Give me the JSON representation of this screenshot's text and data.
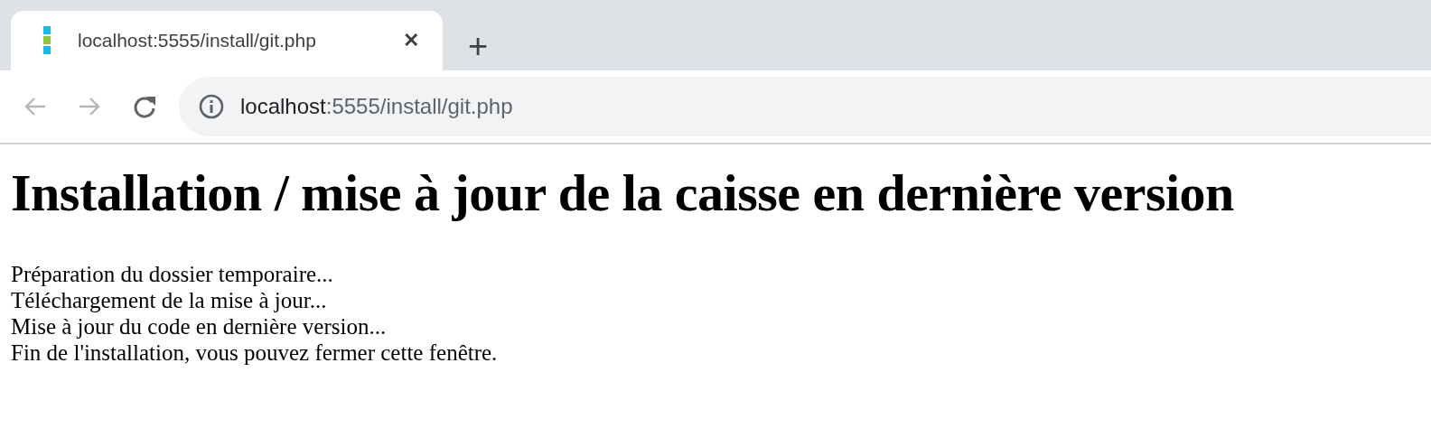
{
  "tab": {
    "title": "localhost:5555/install/git.php",
    "close": "✕",
    "selected": true
  },
  "new_tab": "+",
  "toolbar": {
    "back_disabled": true,
    "forward_disabled": true
  },
  "address": {
    "host": "localhost",
    "rest": ":5555/install/git.php"
  },
  "page": {
    "heading": "Installation / mise à jour de la caisse en dernière version",
    "lines": [
      "Préparation du dossier temporaire...",
      "Téléchargement de la mise à jour...",
      "Mise à jour du code en dernière version...",
      "Fin de l'installation, vous pouvez fermer cette fenêtre."
    ]
  }
}
